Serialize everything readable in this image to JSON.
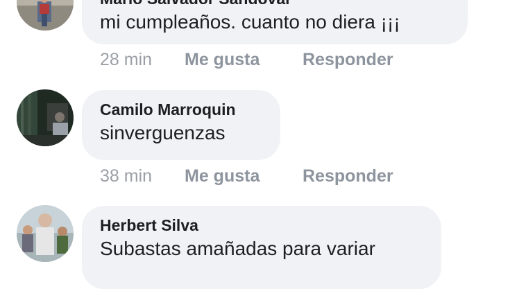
{
  "comments": [
    {
      "author": "Mario Salvador Sandoval",
      "text": "mi cumpleaños. cuanto no diera ¡¡¡",
      "time": "28 min",
      "like_label": "Me gusta",
      "reply_label": "Responder"
    },
    {
      "author": "Camilo Marroquin",
      "text": "sinverguenzas",
      "time": "38 min",
      "like_label": "Me gusta",
      "reply_label": "Responder"
    },
    {
      "author": "Herbert Silva",
      "text": "Subastas amañadas para variar",
      "time": "",
      "like_label": "",
      "reply_label": ""
    }
  ],
  "colors": {
    "bubble_bg": "#f0f2f5",
    "meta_text": "#8d949e",
    "body_text": "#1c1e21"
  }
}
